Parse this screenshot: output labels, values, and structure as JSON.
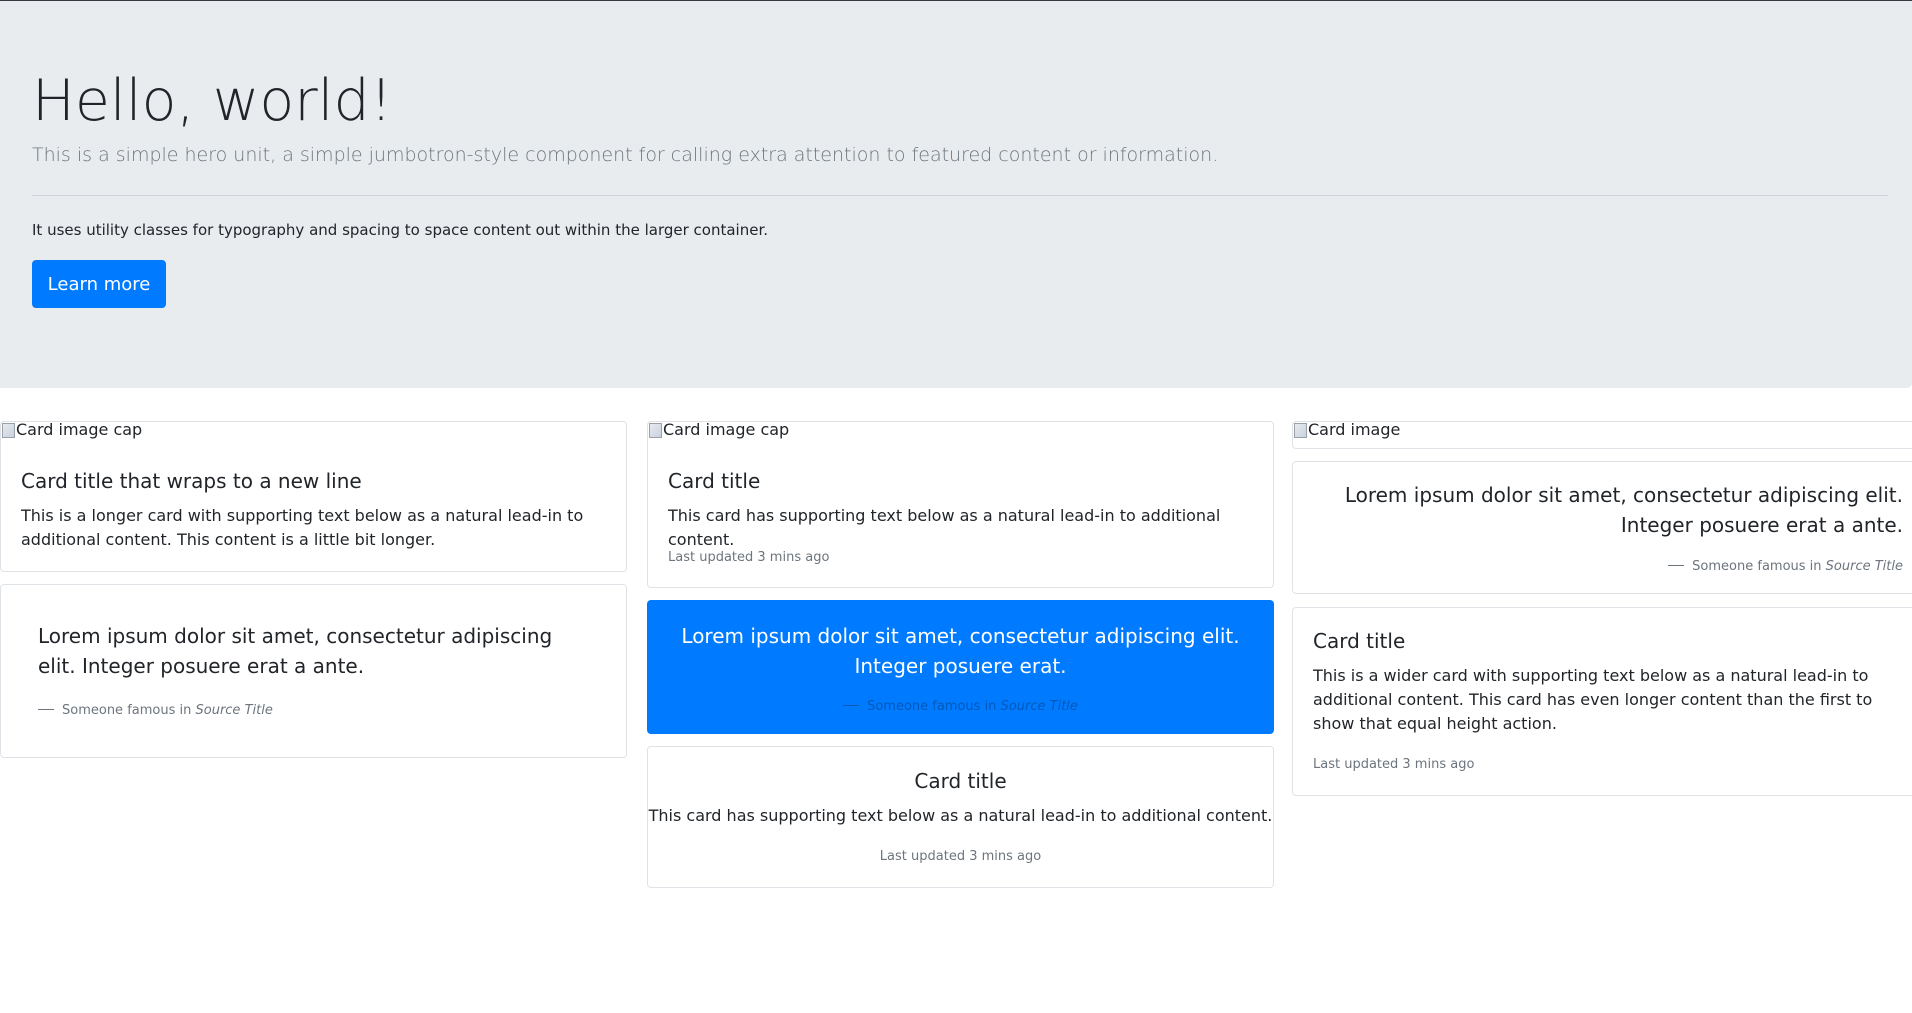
{
  "jumbotron": {
    "title": "Hello, world!",
    "lead": "This is a simple hero unit, a simple jumbotron-style component for calling extra attention to featured content or information.",
    "text": "It uses utility classes for typography and spacing to space content out within the larger container.",
    "button_label": "Learn more"
  },
  "cards": {
    "card1": {
      "image_alt": "Card image cap",
      "title": "Card title that wraps to a new line",
      "text": "This is a longer card with supporting text below as a natural lead-in to additional content. This content is a little bit longer."
    },
    "quote1": {
      "text": "Lorem ipsum dolor sit amet, consectetur adipiscing elit. Integer posuere erat a ante.",
      "footer_prefix": "Someone famous in",
      "footer_cite": "Source Title"
    },
    "card2": {
      "image_alt": "Card image cap",
      "title": "Card title",
      "text": "This card has supporting text below as a natural lead-in to additional content.",
      "muted": "Last updated 3 mins ago"
    },
    "quote2": {
      "text": "Lorem ipsum dolor sit amet, consectetur adipiscing elit. Integer posuere erat.",
      "footer_prefix": "Someone famous in",
      "footer_cite": "Source Title",
      "background_color": "#007bff"
    },
    "card3": {
      "title": "Card title",
      "text": "This card has supporting text below as a natural lead-in to additional content.",
      "muted": "Last updated 3 mins ago"
    },
    "card4": {
      "image_alt": "Card image"
    },
    "quote3": {
      "text": "Lorem ipsum dolor sit amet, consectetur adipiscing elit. Integer posuere erat a ante.",
      "footer_prefix": "Someone famous in",
      "footer_cite": "Source Title"
    },
    "card5": {
      "title": "Card title",
      "text": "This is a wider card with supporting text below as a natural lead-in to additional content. This card has even longer content than the first to show that equal height action.",
      "muted": "Last updated 3 mins ago"
    }
  },
  "colors": {
    "primary": "#007bff",
    "jumbotron_bg": "#e9ecef",
    "muted": "#6c757d"
  }
}
